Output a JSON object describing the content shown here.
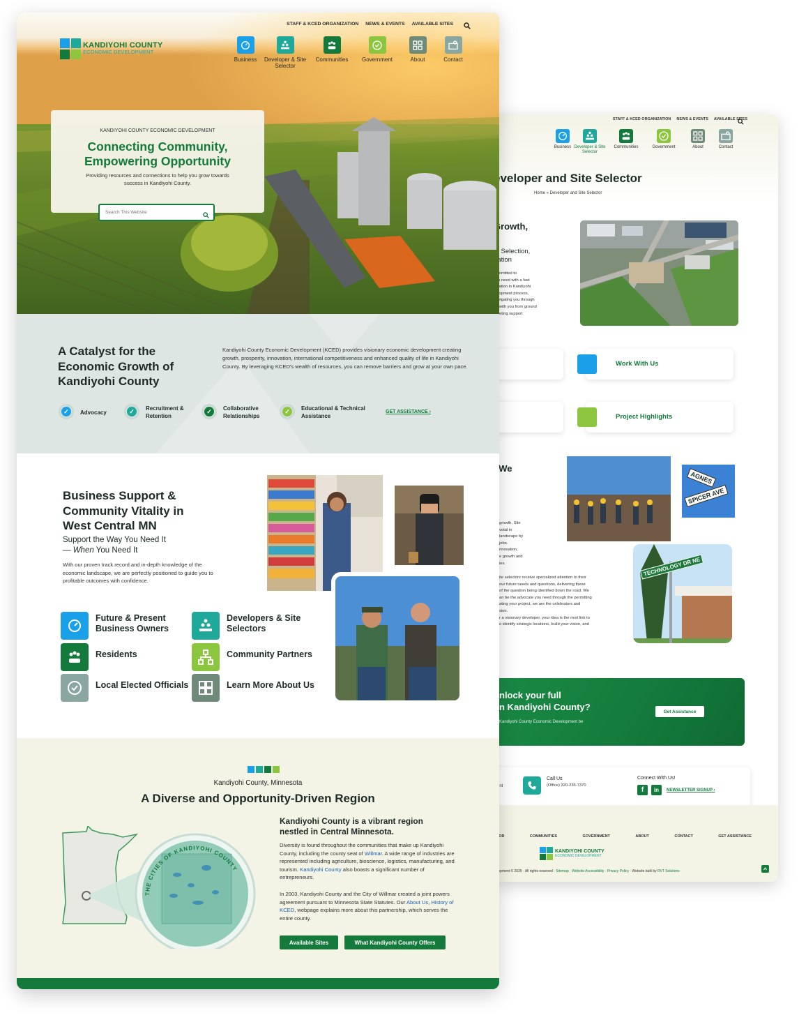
{
  "colors": {
    "primary_green": "#137a3b",
    "light_green": "#8cc63f",
    "blue": "#19a0e8",
    "teal": "#1fa99a",
    "sage": "#8aa6a0",
    "gray_green": "#6f8a78"
  },
  "front": {
    "topnav": [
      "STAFF & KCED ORGANIZATION",
      "NEWS & EVENTS",
      "AVAILABLE SITES"
    ],
    "logo": {
      "line1": "KANDIYOHI COUNTY",
      "line2": "ECONOMIC DEVELOPMENT"
    },
    "mainnav": [
      {
        "label": "Business",
        "icon": "gauge-icon",
        "color": "#19a0e8"
      },
      {
        "label": "Developer & Site Selector",
        "icon": "people-pyramid-icon",
        "color": "#1fa99a"
      },
      {
        "label": "Communities",
        "icon": "community-icon",
        "color": "#137a3b"
      },
      {
        "label": "Government",
        "icon": "seal-icon",
        "color": "#8cc63f"
      },
      {
        "label": "About",
        "icon": "grid-icon",
        "color": "#6f8a78"
      },
      {
        "label": "Contact",
        "icon": "contact-icon",
        "color": "#8aa6a0"
      }
    ],
    "hero": {
      "eyebrow": "KANDIYOHI COUNTY ECONOMIC DEVELOPMENT",
      "title_line1": "Connecting Community,",
      "title_line2": "Empowering Opportunity",
      "desc": "Providing resources and connections to help you grow towards success in Kandiyohi County.",
      "search_placeholder": "Search This Website"
    },
    "catalyst": {
      "title": "A Catalyst for the Economic Growth of Kandiyohi County",
      "body": "Kandiyohi County Economic Development (KCED) provides visionary economic development creating growth, prosperity, innovation, international competitiveness and enhanced quality of life in Kandiyohi County. By leveraging KCED's wealth of resources, you can remove barriers and grow at your own pace.",
      "items": [
        {
          "label": "Advocacy",
          "color": "#19a0e8"
        },
        {
          "label": "Recruitment & Retention",
          "color": "#1fa99a"
        },
        {
          "label": "Collaborative Relationships",
          "color": "#137a3b"
        },
        {
          "label": "Educational & Technical Assistance",
          "color": "#8cc63f"
        }
      ],
      "cta": "GET ASSISTANCE ›"
    },
    "support": {
      "title": "Business Support & Community Vitality in West Central MN",
      "sub1": "Support the Way You Need It",
      "sub2_dash": "— ",
      "sub2_em": "When",
      "sub2_rest": " You Need It",
      "body": "With our proven track record and in-depth knowledge of the economic landscape, we are perfectly positioned to guide you to profitable outcomes with confidence.",
      "tiles": [
        {
          "label": "Future & Present Business Owners",
          "icon": "gauge-icon",
          "color": "#19a0e8"
        },
        {
          "label": "Developers & Site Selectors",
          "icon": "people-pyramid-icon",
          "color": "#1fa99a"
        },
        {
          "label": "Residents",
          "icon": "community-icon",
          "color": "#137a3b"
        },
        {
          "label": "Community Partners",
          "icon": "network-icon",
          "color": "#8cc63f"
        },
        {
          "label": "Local Elected Officials",
          "icon": "seal-icon",
          "color": "#8aa6a0"
        },
        {
          "label": "Learn More About Us",
          "icon": "kced-icon",
          "color": "#6f8a78"
        }
      ]
    },
    "region": {
      "eyebrow": "Kandiyohi County, Minnesota",
      "title": "A Diverse and Opportunity-Driven Region",
      "subtitle": "Kandiyohi County is a vibrant region nestled in Central Minnesota.",
      "p1_a": "Diversity is found throughout the communities that make up Kandiyohi County, including the county seat of ",
      "p1_link1": "Willmar",
      "p1_b": ". A wide range of industries are represented including agriculture, bioscience, logistics, manufacturing, and tourism. ",
      "p1_link2": "Kandiyohi County",
      "p1_c": " also boasts a significant number of entrepreneurs.",
      "p2_a": "In 2003, Kandiyohi County and the City of Willmar created a joint powers agreement pursuant to Minnesota State Statutes. Our ",
      "p2_link1": "About Us",
      "p2_sep": ", ",
      "p2_link2": "History of KCED",
      "p2_b": ", webpage explains more about this partnership, which serves the entire county.",
      "map_ring": "THE CITIES OF KANDIYOHI COUNTY",
      "btn1": "Available Sites",
      "btn2": "What Kandiyohi County Offers"
    }
  },
  "back": {
    "topnav": [
      "STAFF & KCED ORGANIZATION",
      "NEWS & EVENTS",
      "AVAILABLE SITES"
    ],
    "mainnav": [
      "Business",
      "Developer & Site Selector",
      "Communities",
      "Government",
      "About",
      "Contact"
    ],
    "title": "eveloper and Site Selector",
    "breadcrumb": "Home » Developer and Site Selector",
    "h_partial1": "Growth,",
    "h_partial2": "e",
    "h_partial3": "te Selection,",
    "h_partial4": "gation",
    "body_partial": [
      "committed to",
      "you need with a fast",
      "location in Kandiyohi",
      "velopment process,",
      "navigating you through",
      "es with you from ground",
      "arketing support"
    ],
    "cards": [
      {
        "label": "Work With Us",
        "color": "#19a0e8"
      },
      {
        "label": "Project Highlights",
        "color": "#8cc63f"
      }
    ],
    "we_partial": ". We",
    "body2_partial": [
      "growth, Site",
      "votal in",
      "landscape by",
      "jobs.",
      "nnovation,",
      "e growth and",
      "ies."
    ],
    "body3_partial": [
      "ite selectors receive specialized attention to their",
      "our future needs and questions, delivering these",
      "of the question being identified down the road. We",
      "an be the advocate you need through the permitting",
      "ating your project, we are the celebrators and",
      "sion.",
      "r a visionary developer, your idea is the next link to",
      "o identify strategic locations, build your vision, and"
    ],
    "signs": {
      "agnes": "AGNES",
      "spicer": "SPICER AVE",
      "tech": "TECHNOLOGY DR NE"
    },
    "unlock": {
      "line1": "nlock your full",
      "line2": "n Kandiyohi County?",
      "sub": "Kandiyohi County Economic Development be",
      "btn": "Get Assistance"
    },
    "contact": {
      "left": "ment",
      "call_label": "Call Us",
      "call_num": "(Office) 320-235-7370",
      "connect": "Connect With Us!",
      "newsletter": "NEWSLETTER SIGNUP ›"
    },
    "footnav": [
      "CTOR",
      "COMMUNITIES",
      "GOVERNMENT",
      "ABOUT",
      "CONTACT",
      "GET ASSISTANCE"
    ],
    "logo": {
      "line1": "KANDIYOHI COUNTY",
      "line2": "ECONOMIC DEVELOPMENT"
    },
    "copyright": "velopment © 2025 · All rights reserved · ",
    "links": "Sitemap · Website Accessibility · Privacy Policy",
    "built": " · Website built by ",
    "built_by": "RVT Solutions"
  }
}
